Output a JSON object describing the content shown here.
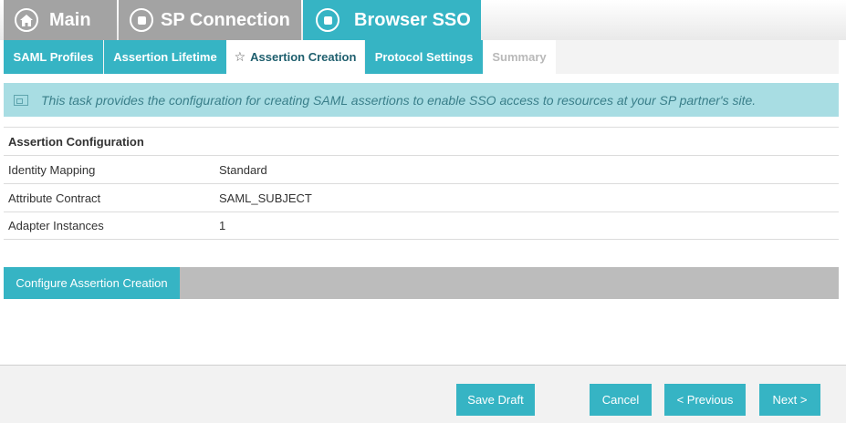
{
  "topnav": {
    "main": "Main",
    "sp_connection": "SP Connection",
    "browser_sso": "Browser SSO"
  },
  "subtabs": [
    {
      "label": "SAML Profiles"
    },
    {
      "label": "Assertion Lifetime"
    },
    {
      "label": "Assertion Creation"
    },
    {
      "label": "Protocol Settings"
    },
    {
      "label": "Summary"
    }
  ],
  "banner": {
    "text": "This task provides the configuration for creating SAML assertions to enable SSO access to resources at your SP partner's site."
  },
  "config": {
    "title": "Assertion Configuration",
    "rows": [
      {
        "label": "Identity Mapping",
        "value": "Standard"
      },
      {
        "label": "Attribute Contract",
        "value": "SAML_SUBJECT"
      },
      {
        "label": "Adapter Instances",
        "value": "1"
      }
    ]
  },
  "actions": {
    "configure": "Configure Assertion Creation"
  },
  "footer": {
    "save_draft": "Save Draft",
    "cancel": "Cancel",
    "previous": "< Previous",
    "next": "Next >"
  },
  "colors": {
    "accent": "#36b4c4",
    "inactive_tab": "#a3a3a3",
    "banner_bg": "#a8dde3"
  }
}
